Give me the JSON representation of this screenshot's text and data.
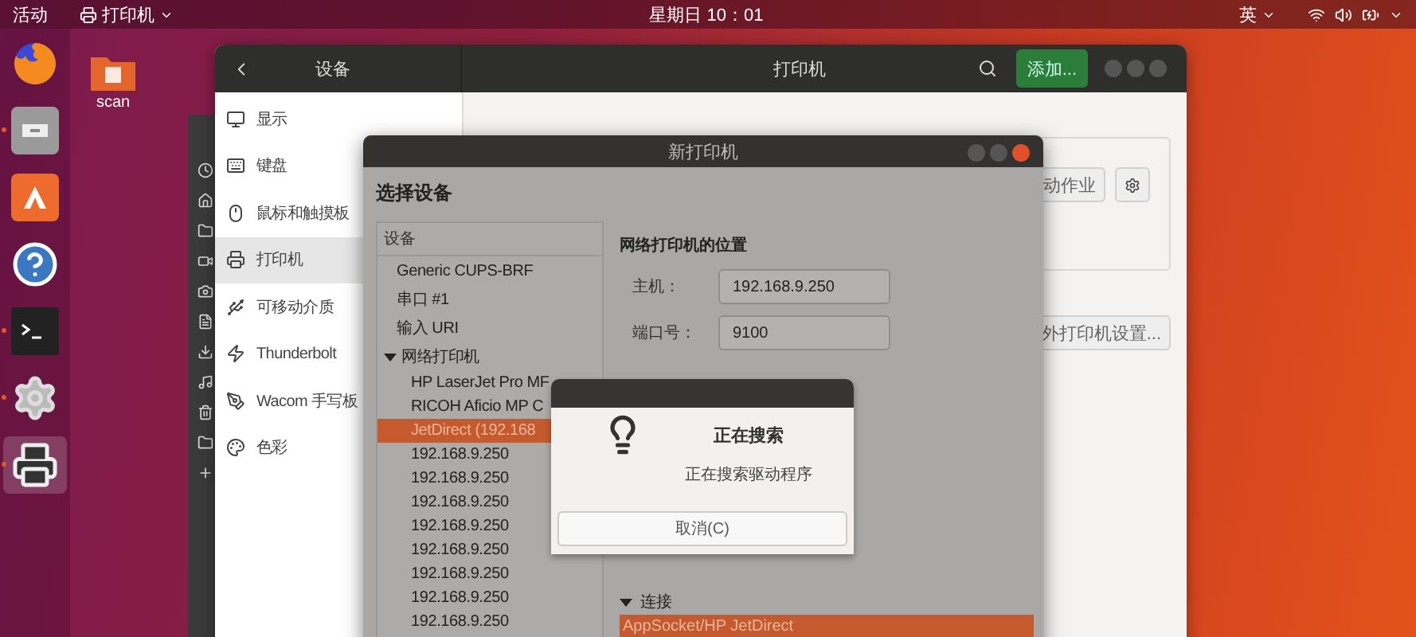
{
  "top_bar": {
    "activities": "活动",
    "app_menu": "打印机",
    "clock": "星期日 10：01",
    "input_method": "英"
  },
  "dock": [
    {
      "kind": "browser",
      "running": false,
      "selected": false
    },
    {
      "kind": "files",
      "running": true,
      "selected": false
    },
    {
      "kind": "software",
      "running": false,
      "selected": false
    },
    {
      "kind": "help",
      "running": false,
      "selected": false
    },
    {
      "kind": "terminal",
      "running": true,
      "selected": false
    },
    {
      "kind": "tools",
      "running": true,
      "selected": false
    },
    {
      "kind": "printer",
      "running": true,
      "selected": true
    }
  ],
  "desktop_icons": [
    {
      "label": "scan"
    }
  ],
  "settings_window": {
    "section_title": "设备",
    "title": "打印机",
    "add_button": "添加...",
    "sidebar": [
      {
        "kind": "display",
        "label": "显示",
        "selected": false
      },
      {
        "kind": "keyboard",
        "label": "键盘",
        "selected": false
      },
      {
        "kind": "mouse",
        "label": "鼠标和触摸板",
        "selected": false
      },
      {
        "kind": "printer",
        "label": "打印机",
        "selected": true
      },
      {
        "kind": "usb",
        "label": "可移动介质",
        "selected": false
      },
      {
        "kind": "thunderbolt",
        "label": "Thunderbolt",
        "selected": false
      },
      {
        "kind": "tablet",
        "label": "Wacom 手写板",
        "selected": false
      },
      {
        "kind": "color",
        "label": "色彩",
        "selected": false
      }
    ],
    "jobs_button": "动作业",
    "extra_settings_button": "外打印机设置..."
  },
  "new_printer_dialog": {
    "title": "新打印机",
    "heading": "选择设备",
    "device_list": {
      "header": "设备",
      "items": [
        {
          "label": "Generic CUPS-BRF",
          "selected": false
        },
        {
          "label": "串口 #1",
          "selected": false
        },
        {
          "label": "输入 URI",
          "selected": false
        },
        {
          "label": "网络打印机",
          "selected": false,
          "expanded": true,
          "children": [
            {
              "label": "HP LaserJet Pro MF",
              "selected": false
            },
            {
              "label": "RICOH Aficio MP C",
              "selected": false
            },
            {
              "label": "JetDirect (192.168",
              "selected": true
            },
            {
              "label": "192.168.9.250",
              "selected": false
            },
            {
              "label": "192.168.9.250",
              "selected": false
            },
            {
              "label": "192.168.9.250",
              "selected": false
            },
            {
              "label": "192.168.9.250",
              "selected": false
            },
            {
              "label": "192.168.9.250",
              "selected": false
            },
            {
              "label": "192.168.9.250",
              "selected": false
            },
            {
              "label": "192.168.9.250",
              "selected": false
            },
            {
              "label": "192.168.9.250",
              "selected": false
            }
          ]
        }
      ]
    },
    "location": {
      "heading": "网络打印机的位置",
      "host_label": "主机：",
      "host": "192.168.9.250",
      "port_label": "端口号：",
      "port": "9100"
    },
    "connection": {
      "label": "连接",
      "expanded": true,
      "items": [
        {
          "label": "AppSocket/HP JetDirect",
          "selected": true
        }
      ]
    }
  },
  "search_dialog": {
    "title": "正在搜索",
    "message": "正在搜索驱动程序",
    "cancel": "取消(C)"
  }
}
